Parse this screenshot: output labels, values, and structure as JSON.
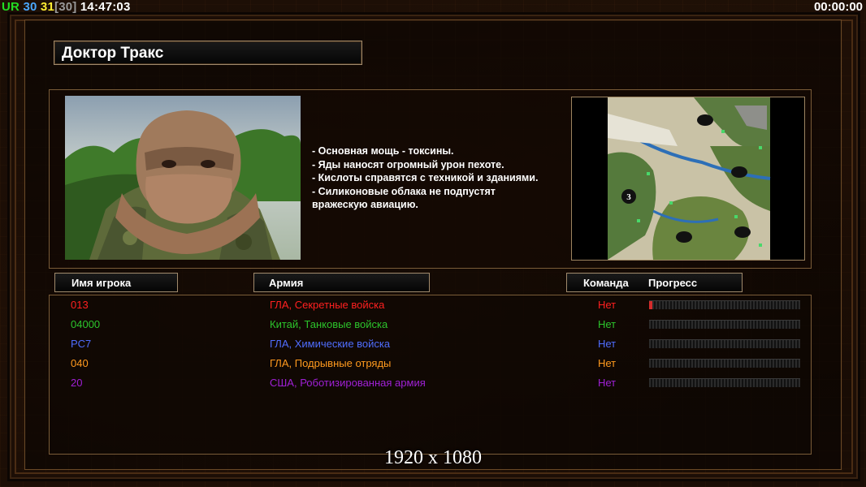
{
  "hud": {
    "ur_label": "UR",
    "fps1": "30",
    "fps2": "31",
    "fps_limit": "[30]",
    "clock": "14:47:03",
    "timer": "00:00:00"
  },
  "colors": {
    "ur": "#22dd22",
    "fps1": "#4aa8ff",
    "fps2": "#ffee33",
    "fps_limit": "#999999",
    "accent_frame": "#a08a6c"
  },
  "general": {
    "name": "Доктор Тракс",
    "description": "- Основная мощь - токсины.\n- Яды наносят огромный урон пехоте.\n- Кислоты справятся с техникой и зданиями.\n- Силиконовые облака не подпустят\n  вражескую авиацию.",
    "portrait_icon": "soldier-portrait",
    "map_marker": "3"
  },
  "columns": {
    "player": "Имя игрока",
    "army": "Армия",
    "team": "Команда",
    "progress": "Прогресс"
  },
  "players": [
    {
      "name": "013",
      "army": "ГЛА, Секретные войска",
      "team": "Нет",
      "color": "#ff2020",
      "progress": 0.02
    },
    {
      "name": "04000",
      "army": "Китай, Танковые войска",
      "team": "Нет",
      "color": "#2cc42c",
      "progress": 0
    },
    {
      "name": "PC7",
      "army": "ГЛА, Химические войска",
      "team": "Нет",
      "color": "#4f6dff",
      "progress": 0
    },
    {
      "name": "040",
      "army": "ГЛА, Подрывные отряды",
      "team": "Нет",
      "color": "#ff9a1e",
      "progress": 0
    },
    {
      "name": "20",
      "army": "США, Роботизированная армия",
      "team": "Нет",
      "color": "#a020d6",
      "progress": 0
    }
  ],
  "resolution": "1920 x 1080"
}
